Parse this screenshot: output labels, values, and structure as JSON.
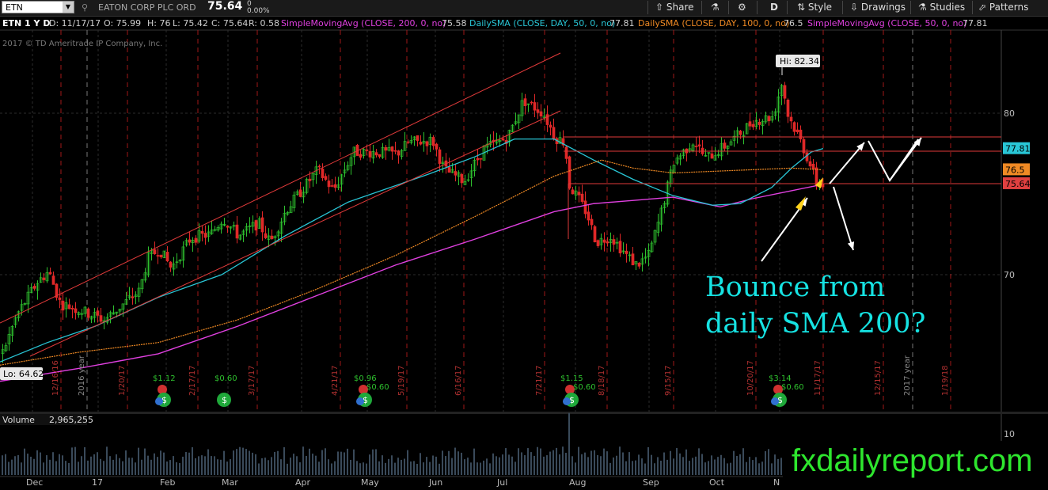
{
  "toolbar": {
    "symbol": "ETN",
    "company": "EATON CORP PLC ORD",
    "last": "75.64",
    "change": "0",
    "change_pct": "0.00%",
    "share_label": "Share",
    "period_label": "D",
    "style_label": "Style",
    "drawings_label": "Drawings",
    "studies_label": "Studies",
    "patterns_label": "Patterns"
  },
  "info": {
    "chart_label": "ETN 1 Y D",
    "date": "D: 11/17/17",
    "open": "O: 75.99",
    "high": "H: 76",
    "low": "L: 75.42",
    "close": "C: 75.64",
    "range": "R: 0.58",
    "studies": [
      {
        "label": "SimpleMovingAvg (CLOSE, 200, 0, no)",
        "value": "75.58",
        "color": "#e040e0"
      },
      {
        "label": "DailySMA (CLOSE, DAY, 50, 0, no)",
        "value": "77.81",
        "color": "#29c6d6"
      },
      {
        "label": "DailySMA (CLOSE, DAY, 100, 0, no)",
        "value": "76.5",
        "color": "#f08a24"
      },
      {
        "label": "SimpleMovingAvg (CLOSE, 50, 0, no)",
        "value": "77.81",
        "color": "#e040e0"
      }
    ]
  },
  "copyright": "2017 © TD Ameritrade IP Company, Inc.",
  "chart_data": {
    "type": "candlestick",
    "symbol": "ETN",
    "period": "1 Y D",
    "y_ticks": [
      70,
      80
    ],
    "ylim": [
      62,
      86
    ],
    "hi_label": "Hi: 82.34",
    "lo_label": "Lo: 64.62",
    "price_tags": [
      {
        "value": 77.81,
        "label": "77.81",
        "color": "#29c6d6"
      },
      {
        "value": 76.5,
        "label": "76.5",
        "color": "#f08a24"
      },
      {
        "value": 75.64,
        "label": "75.64",
        "color": "#e04040"
      }
    ],
    "month_labels": [
      "Dec",
      "17",
      "Feb",
      "Mar",
      "Apr",
      "May",
      "Jun",
      "Jul",
      "Aug",
      "Sep",
      "Oct",
      "N"
    ],
    "date_markers": [
      "12/16/16",
      "2016 year",
      "1/20/17",
      "2/17/17",
      "3/17/17",
      "4/21/17",
      "5/19/17",
      "6/16/17",
      "7/21/17",
      "8/18/17",
      "9/15/17",
      "10/20/17",
      "11/17/17",
      "12/15/17",
      "2017 year",
      "1/19/18"
    ],
    "events": [
      {
        "label": "$1.12",
        "type": "earnings+dividend"
      },
      {
        "label": "$0.60",
        "type": "dividend"
      },
      {
        "label": "$0.96",
        "extra": "$0.60",
        "type": "earnings+dividend"
      },
      {
        "label": "$1.15",
        "extra": "$0.60",
        "type": "earnings+dividend"
      },
      {
        "label": "$3.14",
        "extra": "$0.60",
        "type": "earnings+dividend"
      }
    ],
    "volume_label": "Volume",
    "volume_value": "2,965,255",
    "volume_tick": "10",
    "series": [
      {
        "name": "SimpleMovingAvg (CLOSE, 200, 0, no)",
        "color": "#e040e0",
        "last": 75.58
      },
      {
        "name": "DailySMA (CLOSE, DAY, 50, 0, no)",
        "color": "#29c6d6",
        "last": 77.81
      },
      {
        "name": "DailySMA (CLOSE, DAY, 100, 0, no)",
        "color": "#f08a24",
        "last": 76.5
      }
    ]
  },
  "annotation": {
    "line1": "Bounce from",
    "line2": "daily SMA 200?"
  },
  "watermark": "fxdailyreport.com"
}
